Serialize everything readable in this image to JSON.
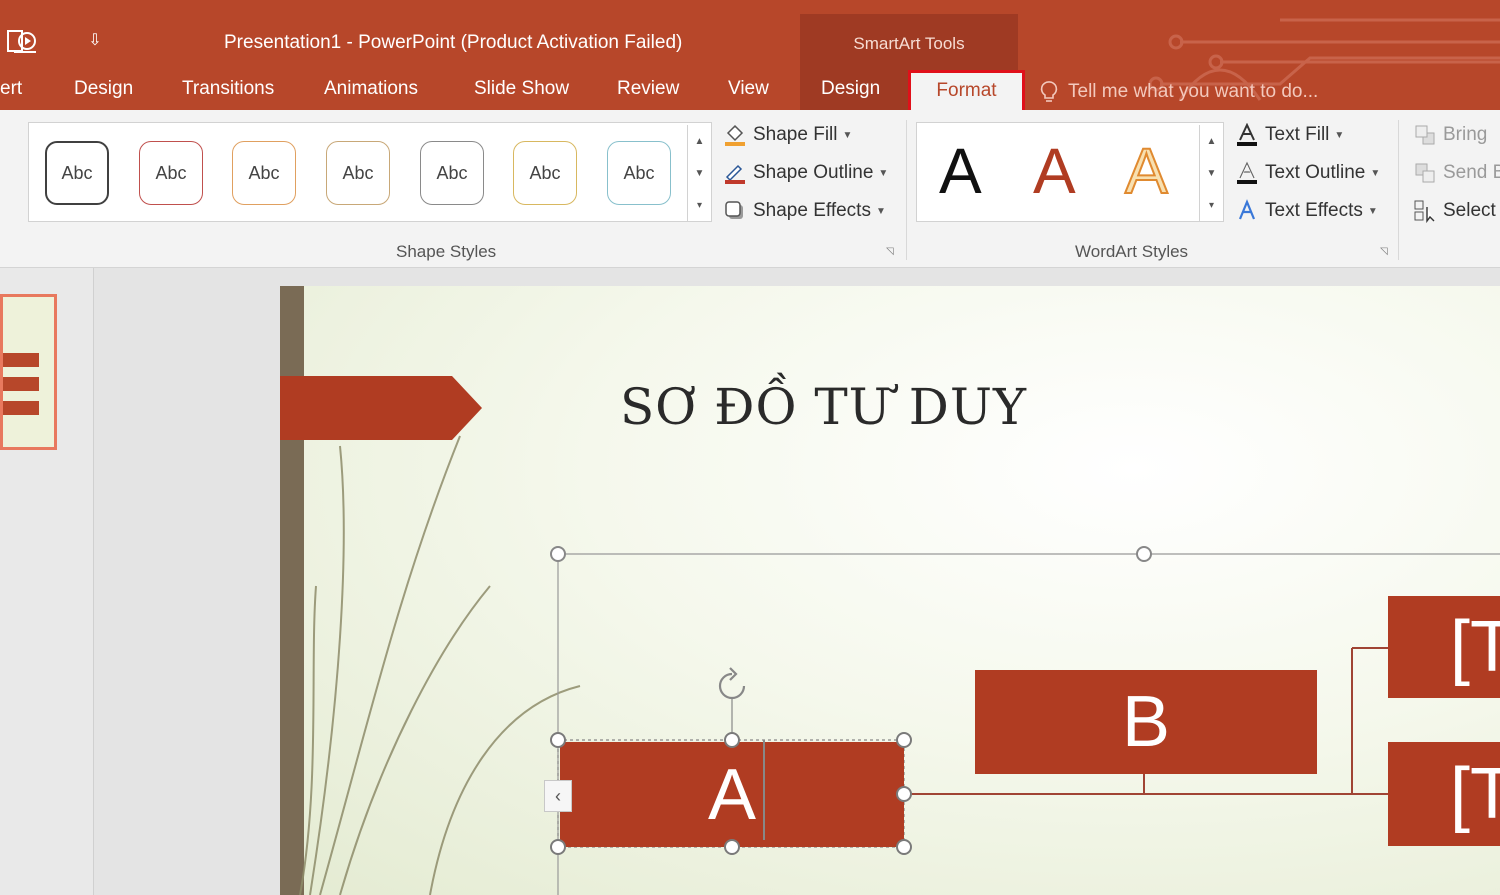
{
  "title_bar": {
    "qat_glyph": "⇩",
    "window_title": "Presentation1 - PowerPoint (Product Activation Failed)",
    "contextual_tab_group": "SmartArt Tools"
  },
  "tabs": [
    {
      "label": "ert"
    },
    {
      "label": "Design"
    },
    {
      "label": "Transitions"
    },
    {
      "label": "Animations"
    },
    {
      "label": "Slide Show"
    },
    {
      "label": "Review"
    },
    {
      "label": "View"
    },
    {
      "label": "Design"
    }
  ],
  "active_tab": "Format",
  "tell_me": "Tell me what you want to do...",
  "ribbon": {
    "shape_styles": {
      "thumbnails": [
        {
          "label": "Abc",
          "color": "#404040"
        },
        {
          "label": "Abc",
          "color": "#c0504d"
        },
        {
          "label": "Abc",
          "color": "#e0a060"
        },
        {
          "label": "Abc",
          "color": "#c8a878"
        },
        {
          "label": "Abc",
          "color": "#8a8a8a"
        },
        {
          "label": "Abc",
          "color": "#d8b860"
        },
        {
          "label": "Abc",
          "color": "#88c0cc"
        }
      ],
      "commands": [
        {
          "label": "Shape Fill",
          "icon": "paint-bucket-icon"
        },
        {
          "label": "Shape Outline",
          "icon": "pencil-outline-icon"
        },
        {
          "label": "Shape Effects",
          "icon": "shape-effects-icon"
        }
      ],
      "group_label": "Shape Styles"
    },
    "wordart_styles": {
      "samples": [
        {
          "glyph": "A",
          "style": "black"
        },
        {
          "glyph": "A",
          "style": "red-fill"
        },
        {
          "glyph": "A",
          "style": "orange-outline"
        }
      ],
      "commands": [
        {
          "label": "Text Fill",
          "icon": "text-fill-icon"
        },
        {
          "label": "Text Outline",
          "icon": "text-outline-icon"
        },
        {
          "label": "Text Effects",
          "icon": "text-effects-icon"
        }
      ],
      "group_label": "WordArt Styles"
    },
    "arrange": {
      "commands": [
        {
          "label": "Bring",
          "icon": "bring-forward-icon",
          "enabled": false
        },
        {
          "label": "Send B",
          "icon": "send-backward-icon",
          "enabled": false
        },
        {
          "label": "Select",
          "icon": "selection-pane-icon",
          "enabled": true
        }
      ]
    }
  },
  "slide": {
    "title": "SƠ ĐỒ TƯ DUY",
    "nodes": {
      "a": "A",
      "b": "B",
      "right_1": "[T",
      "right_2": "[T"
    }
  },
  "colors": {
    "accent": "#b7472a",
    "node_fill": "#b03c22",
    "highlight_box": "#e0101a"
  }
}
